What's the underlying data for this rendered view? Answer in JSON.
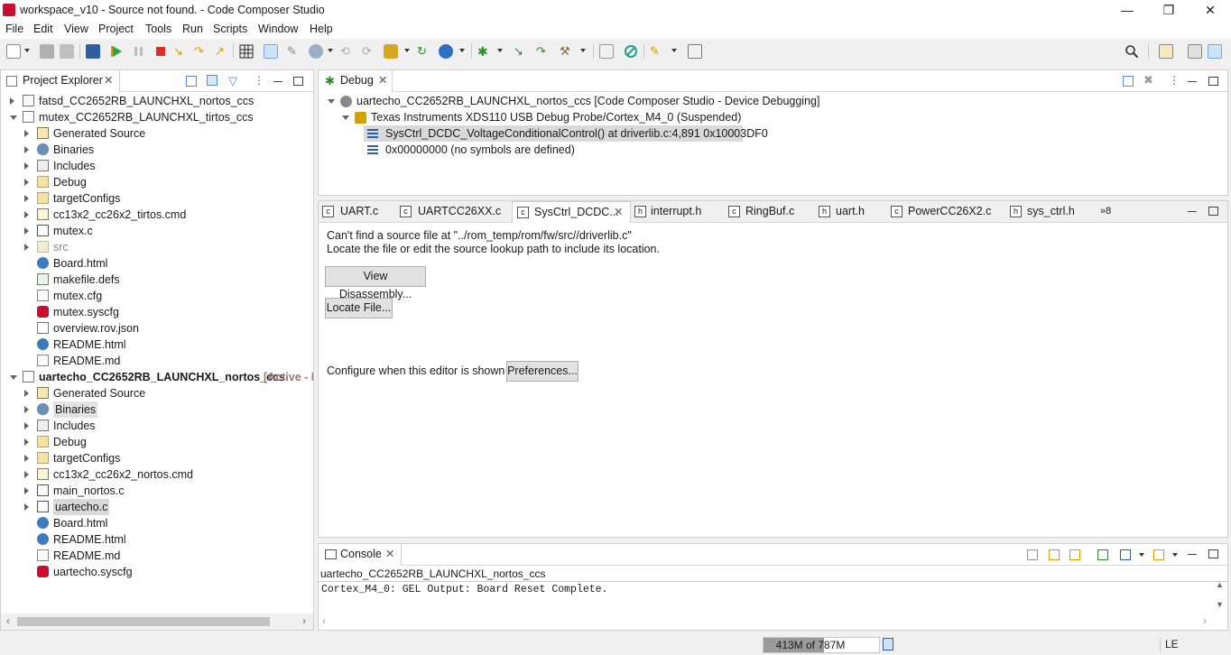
{
  "window": {
    "title": "workspace_v10 - Source not found. - Code Composer Studio",
    "minimize": "—",
    "maximize": "❐",
    "close": "✕"
  },
  "menu": [
    "File",
    "Edit",
    "View",
    "Project",
    "Tools",
    "Run",
    "Scripts",
    "Window",
    "Help"
  ],
  "project_explorer": {
    "title": "Project Explorer",
    "items": [
      {
        "label": "fatsd_CC2652RB_LAUNCHXL_nortos_ccs",
        "level": 0,
        "expanded": false,
        "icon": "project-icon"
      },
      {
        "label": "mutex_CC2652RB_LAUNCHXL_tirtos_ccs",
        "level": 0,
        "expanded": true,
        "icon": "project-icon"
      },
      {
        "label": "Generated Source",
        "level": 1,
        "expanded": false,
        "icon": "folder-source-icon"
      },
      {
        "label": "Binaries",
        "level": 1,
        "expanded": false,
        "icon": "binaries-icon"
      },
      {
        "label": "Includes",
        "level": 1,
        "expanded": false,
        "icon": "includes-icon"
      },
      {
        "label": "Debug",
        "level": 1,
        "expanded": false,
        "icon": "folder-icon"
      },
      {
        "label": "targetConfigs",
        "level": 1,
        "expanded": false,
        "icon": "folder-icon"
      },
      {
        "label": "cc13x2_cc26x2_tirtos.cmd",
        "level": 1,
        "expanded": false,
        "icon": "cmd-file-icon"
      },
      {
        "label": "mutex.c",
        "level": 1,
        "expanded": false,
        "icon": "c-file-icon"
      },
      {
        "label": "src",
        "level": 1,
        "expanded": false,
        "icon": "folder-excluded-icon",
        "dim": true
      },
      {
        "label": "Board.html",
        "level": 1,
        "icon": "html-file-icon"
      },
      {
        "label": "makefile.defs",
        "level": 1,
        "icon": "defs-file-icon"
      },
      {
        "label": "mutex.cfg",
        "level": 1,
        "icon": "file-icon"
      },
      {
        "label": "mutex.syscfg",
        "level": 1,
        "icon": "syscfg-icon"
      },
      {
        "label": "overview.rov.json",
        "level": 1,
        "icon": "json-file-icon"
      },
      {
        "label": "README.html",
        "level": 1,
        "icon": "html-file-icon"
      },
      {
        "label": "README.md",
        "level": 1,
        "icon": "file-icon"
      },
      {
        "label": "uartecho_CC2652RB_LAUNCHXL_nortos_ccs",
        "level": 0,
        "expanded": true,
        "icon": "project-icon",
        "bold": true,
        "suffix": "[Active - D"
      },
      {
        "label": "Generated Source",
        "level": 1,
        "expanded": false,
        "icon": "folder-source-icon"
      },
      {
        "label": "Binaries",
        "level": 1,
        "expanded": false,
        "icon": "binaries-icon",
        "highlight": true
      },
      {
        "label": "Includes",
        "level": 1,
        "expanded": false,
        "icon": "includes-icon"
      },
      {
        "label": "Debug",
        "level": 1,
        "expanded": false,
        "icon": "folder-icon"
      },
      {
        "label": "targetConfigs",
        "level": 1,
        "expanded": false,
        "icon": "folder-icon"
      },
      {
        "label": "cc13x2_cc26x2_nortos.cmd",
        "level": 1,
        "expanded": false,
        "icon": "cmd-file-icon"
      },
      {
        "label": "main_nortos.c",
        "level": 1,
        "expanded": false,
        "icon": "c-file-icon"
      },
      {
        "label": "uartecho.c",
        "level": 1,
        "expanded": false,
        "icon": "c-file-icon",
        "selected": true
      },
      {
        "label": "Board.html",
        "level": 1,
        "icon": "html-file-icon"
      },
      {
        "label": "README.html",
        "level": 1,
        "icon": "html-file-icon"
      },
      {
        "label": "README.md",
        "level": 1,
        "icon": "file-icon"
      },
      {
        "label": "uartecho.syscfg",
        "level": 1,
        "icon": "syscfg-icon"
      }
    ]
  },
  "debug_view": {
    "title": "Debug",
    "session": "uartecho_CC2652RB_LAUNCHXL_nortos_ccs [Code Composer Studio - Device Debugging]",
    "probe": "Texas Instruments XDS110 USB Debug Probe/Cortex_M4_0 (Suspended)",
    "frames": [
      "SysCtrl_DCDC_VoltageConditionalControl() at driverlib.c:4,891 0x10003DF0",
      "0x00000000  (no symbols are defined)"
    ]
  },
  "editor": {
    "tabs": [
      {
        "label": "UART.c",
        "icon": "c-file-icon"
      },
      {
        "label": "UARTCC26XX.c",
        "icon": "c-file-icon"
      },
      {
        "label": "SysCtrl_DCDC...",
        "icon": "c-file-icon",
        "active": true
      },
      {
        "label": "interrupt.h",
        "icon": "h-file-icon"
      },
      {
        "label": "RingBuf.c",
        "icon": "c-file-icon"
      },
      {
        "label": "uart.h",
        "icon": "h-file-icon"
      },
      {
        "label": "PowerCC26X2.c",
        "icon": "c-file-icon"
      },
      {
        "label": "sys_ctrl.h",
        "icon": "h-file-icon"
      }
    ],
    "overflow": "»8",
    "message_line1": "Can't find a source file at \"../rom_temp/rom/fw/src//driverlib.c\"",
    "message_line2": "Locate the file or edit the source lookup path to include its location.",
    "view_disassembly": "View Disassembly...",
    "locate_file": "Locate File...",
    "configure_label": "Configure when this editor is shown",
    "preferences": "Preferences..."
  },
  "console": {
    "title": "Console",
    "header": "uartecho_CC2652RB_LAUNCHXL_nortos_ccs",
    "output": "Cortex_M4_0: GEL Output: Board Reset Complete."
  },
  "status": {
    "heap": "413M of 787M",
    "heap_used_fraction": 0.525,
    "endian": "LE"
  },
  "colors": {
    "accent": "#0078d7",
    "selection": "#e5f3ff",
    "highlight_row": "#d6d6d6",
    "active_suffix": "#a0786e"
  }
}
